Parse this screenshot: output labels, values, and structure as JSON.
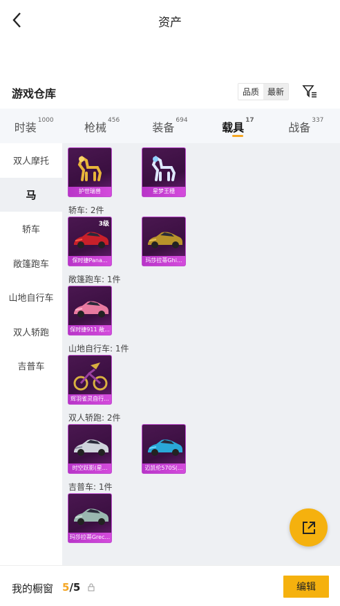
{
  "header": {
    "title": "资产"
  },
  "warehouse": {
    "title": "游戏仓库",
    "sort_quality": "品质",
    "sort_newest": "最新"
  },
  "tabs": [
    {
      "label": "时装",
      "count": "1000"
    },
    {
      "label": "枪械",
      "count": "456"
    },
    {
      "label": "装备",
      "count": "694"
    },
    {
      "label": "载具",
      "count": "17",
      "active": true
    },
    {
      "label": "战备",
      "count": "337"
    }
  ],
  "sidebar": {
    "items": [
      "双人摩托",
      "马",
      "轿车",
      "敞篷跑车",
      "山地自行车",
      "双人轿跑",
      "吉普车"
    ],
    "active_index": 1
  },
  "sections": [
    {
      "label": "",
      "items": [
        {
          "name": "护世瑞兽",
          "level": ""
        },
        {
          "name": "星梦王穗",
          "level": ""
        }
      ]
    },
    {
      "label": "轿车: 2件",
      "items": [
        {
          "name": "保时捷Pana...",
          "level": "3级"
        },
        {
          "name": "玛莎拉蒂Ghi...",
          "level": ""
        }
      ]
    },
    {
      "label": "敞篷跑车: 1件",
      "items": [
        {
          "name": "保时捷911 敞...",
          "level": ""
        }
      ]
    },
    {
      "label": "山地自行车: 1件",
      "items": [
        {
          "name": "辉羽雀灵自行...",
          "level": ""
        }
      ]
    },
    {
      "label": "双人轿跑: 2件",
      "items": [
        {
          "name": "时空跃影(星...",
          "level": ""
        },
        {
          "name": "迈凯伦570S(...",
          "level": ""
        }
      ]
    },
    {
      "label": "吉普车: 1件",
      "items": [
        {
          "name": "玛莎拉蒂Grec...",
          "level": ""
        }
      ]
    }
  ],
  "bottom": {
    "label": "我的橱窗",
    "current": "5",
    "total": "/5",
    "edit": "编辑"
  },
  "colors": {
    "accent": "#f5b10e",
    "card_border": "#c04ed0"
  },
  "icons": [
    "back-icon",
    "filter-icon",
    "lock-icon",
    "share-icon"
  ]
}
